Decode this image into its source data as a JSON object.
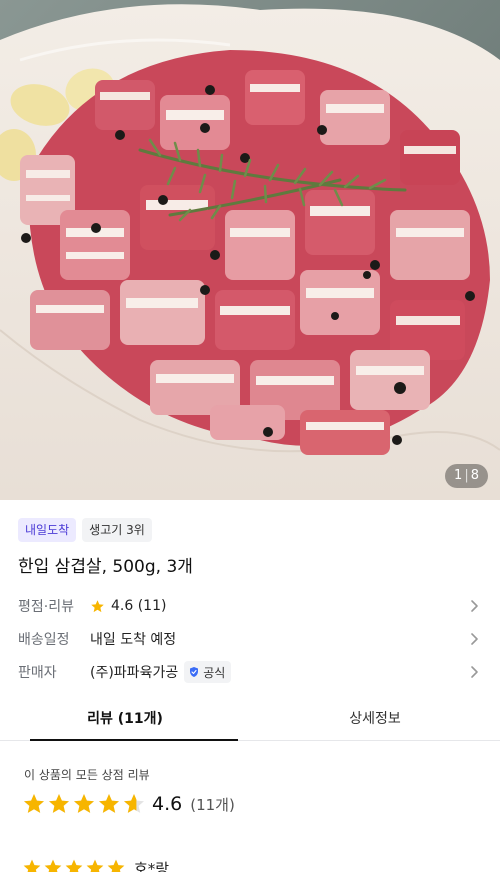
{
  "image": {
    "alt": "product-photo-pork-belly",
    "counter": {
      "current": "1",
      "separator": "|",
      "total": "8"
    }
  },
  "badges": {
    "delivery": "내일도착",
    "rank": "생고기 3위"
  },
  "product": {
    "title": "한입 삼겹살, 500g, 3개"
  },
  "info": {
    "rating_label": "평점·리뷰",
    "rating_value": "4.6 (11)",
    "shipping_label": "배송일정",
    "shipping_value": "내일 도착 예정",
    "seller_label": "판매자",
    "seller_name": "(주)파파육가공",
    "seller_official": "공식"
  },
  "tabs": [
    {
      "label": "리뷰 (11개)",
      "active": true
    },
    {
      "label": "상세정보",
      "active": false
    }
  ],
  "reviews": {
    "caption": "이 상품의 모든 상점 리뷰",
    "average": "4.6",
    "average_value": 4.6,
    "count": "(11개)",
    "first_review": {
      "rating": 5,
      "author": "호*랑"
    }
  },
  "colors": {
    "star": "#f7b500",
    "star_empty": "#e3e3e3",
    "delivery_badge_bg": "#eceaff",
    "delivery_badge_text": "#4b3bd6",
    "official_check": "#3b6cf6"
  },
  "icons": {
    "rating": "star-icon",
    "chevron": "chevron-right-icon",
    "official": "verified-shield-icon"
  }
}
